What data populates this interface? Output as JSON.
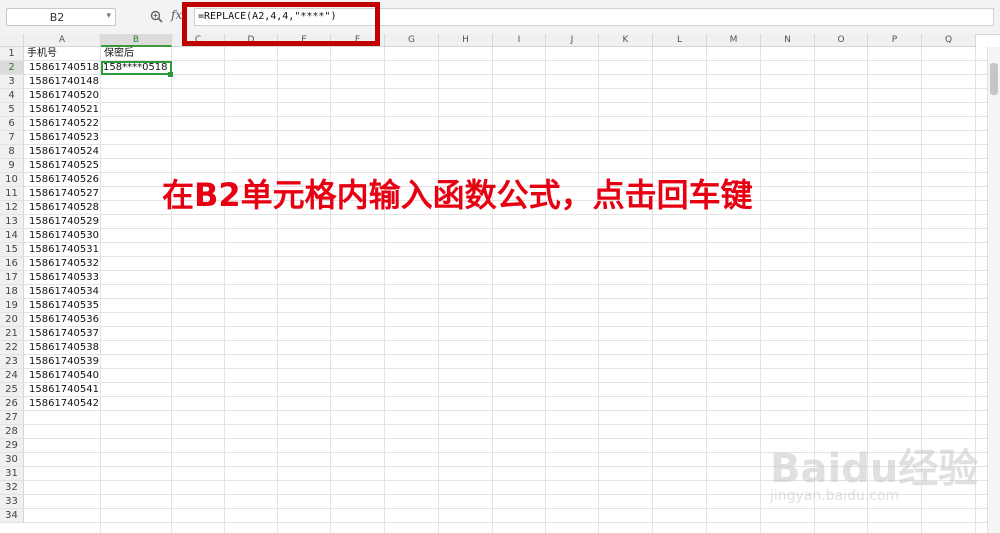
{
  "formula_bar": {
    "name_box": "B2",
    "fx_label": "fx",
    "formula": "=REPLACE(A2,4,4,\"****\")"
  },
  "columns": [
    "A",
    "B",
    "C",
    "D",
    "E",
    "F",
    "G",
    "H",
    "I",
    "J",
    "K",
    "L",
    "M",
    "N",
    "O",
    "P",
    "Q"
  ],
  "rows": [
    "1",
    "2",
    "3",
    "4",
    "5",
    "6",
    "7",
    "8",
    "9",
    "10",
    "11",
    "12",
    "13",
    "14",
    "15",
    "16",
    "17",
    "18",
    "19",
    "20",
    "21",
    "22",
    "23",
    "24",
    "25",
    "26",
    "27",
    "28",
    "29",
    "30",
    "31",
    "32",
    "33",
    "34"
  ],
  "headers": {
    "a1": "手机号",
    "b1": "保密后"
  },
  "phone_numbers": [
    "15861740518",
    "15861740148",
    "15861740520",
    "15861740521",
    "15861740522",
    "15861740523",
    "15861740524",
    "15861740525",
    "15861740526",
    "15861740527",
    "15861740528",
    "15861740529",
    "15861740530",
    "15861740531",
    "15861740532",
    "15861740533",
    "15861740534",
    "15861740535",
    "15861740536",
    "15861740537",
    "15861740538",
    "15861740539",
    "15861740540",
    "15861740541",
    "15861740542"
  ],
  "b2_value": "158****0518",
  "annotation": "在B2单元格内输入函数公式，点击回车键",
  "watermark": {
    "logo": "Baidu经验",
    "url": "jingyan.baidu.com"
  },
  "colors": {
    "highlight": "#c00000",
    "annotation": "#e60012",
    "selection": "#2e9a3d"
  }
}
